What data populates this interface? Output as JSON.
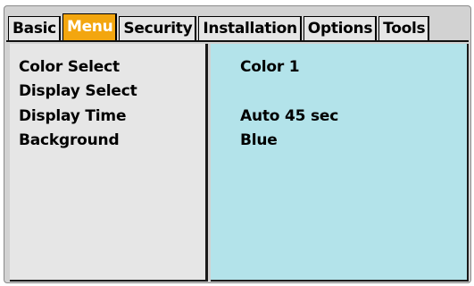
{
  "tabs": [
    {
      "label": "Basic",
      "active": false
    },
    {
      "label": "Menu",
      "active": true
    },
    {
      "label": "Security",
      "active": false
    },
    {
      "label": "Installation",
      "active": false
    },
    {
      "label": "Options",
      "active": false
    },
    {
      "label": "Tools",
      "active": false
    }
  ],
  "menu": {
    "rows": [
      {
        "label": "Color Select",
        "value": "Color 1"
      },
      {
        "label": "Display Select",
        "value": ""
      },
      {
        "label": "Display Time",
        "value": "Auto 45 sec"
      },
      {
        "label": "Background",
        "value": "Blue"
      }
    ]
  },
  "colors": {
    "active_tab": "#f3a60f",
    "value_panel": "#b3e3ea",
    "label_panel": "#e6e6e6",
    "frame": "#d2d2d2"
  }
}
